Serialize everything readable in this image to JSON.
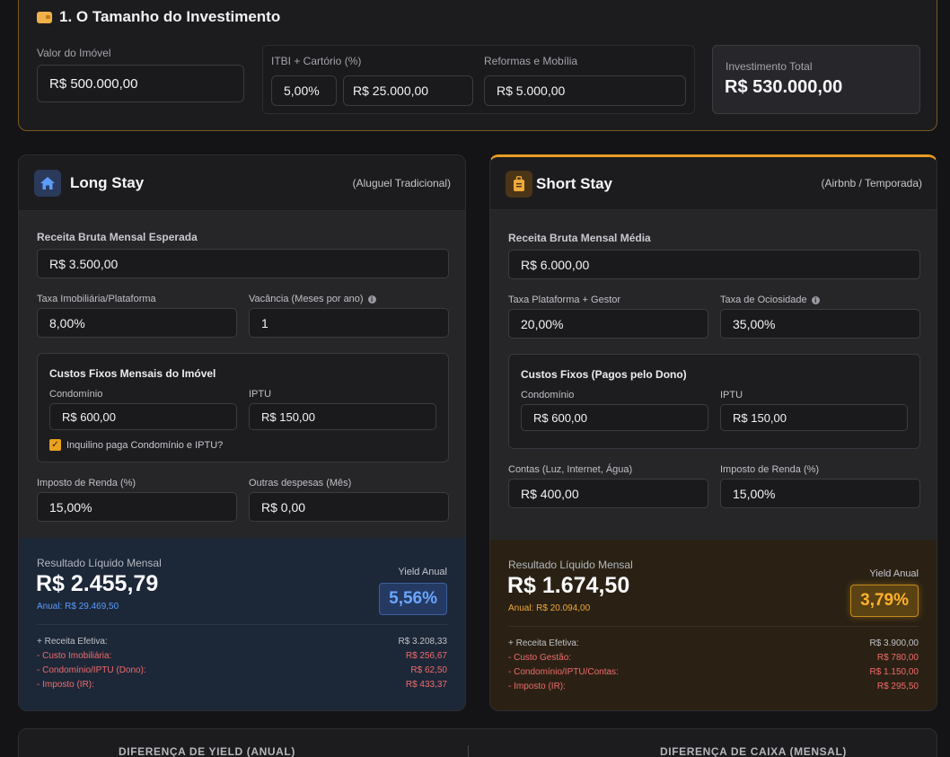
{
  "investment": {
    "title": "1. O Tamanho do Investimento",
    "property_value_label": "Valor do Imóvel",
    "property_value": "R$ 500.000,00",
    "itbi_label": "ITBI + Cartório (%)",
    "itbi_percent": "5,00%",
    "itbi_amount": "R$ 25.000,00",
    "renovation_label": "Reformas e Mobília",
    "renovation_value": "R$ 5.000,00",
    "total_label": "Investimento Total",
    "total_value": "R$ 530.000,00"
  },
  "long_stay": {
    "title": "Long Stay",
    "subtitle": "(Aluguel Tradicional)",
    "gross_label": "Receita Bruta Mensal Esperada",
    "gross_value": "R$ 3.500,00",
    "fee_label": "Taxa Imobiliária/Plataforma",
    "fee_value": "8,00%",
    "vacancy_label": "Vacância (Meses por ano)",
    "vacancy_value": "1",
    "fixed_title": "Custos Fixos Mensais do Imóvel",
    "condo_label": "Condomínio",
    "condo_value": "R$ 600,00",
    "iptu_label": "IPTU",
    "iptu_value": "R$ 150,00",
    "tenant_pays_label": "Inquilino paga Condomínio e IPTU?",
    "tax_label": "Imposto de Renda (%)",
    "tax_value": "15,00%",
    "other_label": "Outras despesas (Mês)",
    "other_value": "R$ 0,00",
    "result_label": "Resultado Líquido Mensal",
    "result_value": "R$ 2.455,79",
    "annual": "Anual: R$ 29.469,50",
    "yield_label": "Yield Anual",
    "yield_value": "5,56%",
    "breakdown": [
      {
        "label": "+ Receita Efetiva:",
        "value": "R$ 3.208,33"
      },
      {
        "label": "- Custo Imobiliária:",
        "value": "R$ 256,67"
      },
      {
        "label": "- Condomínio/IPTU (Dono):",
        "value": "R$ 62,50"
      },
      {
        "label": "- Imposto (IR):",
        "value": "R$ 433,37"
      }
    ]
  },
  "short_stay": {
    "title": "Short Stay",
    "subtitle": "(Airbnb / Temporada)",
    "gross_label": "Receita Bruta Mensal Média",
    "gross_value": "R$ 6.000,00",
    "fee_label": "Taxa Plataforma + Gestor",
    "fee_value": "20,00%",
    "idle_label": "Taxa de Ociosidade",
    "idle_value": "35,00%",
    "fixed_title": "Custos Fixos (Pagos pelo Dono)",
    "condo_label": "Condomínio",
    "condo_value": "R$ 600,00",
    "iptu_label": "IPTU",
    "iptu_value": "R$ 150,00",
    "bills_label": "Contas (Luz, Internet, Água)",
    "bills_value": "R$ 400,00",
    "tax_label": "Imposto de Renda (%)",
    "tax_value": "15,00%",
    "result_label": "Resultado Líquido Mensal",
    "result_value": "R$ 1.674,50",
    "annual": "Anual: R$ 20.094,00",
    "yield_label": "Yield Anual",
    "yield_value": "3,79%",
    "breakdown": [
      {
        "label": "+ Receita Efetiva:",
        "value": "R$ 3.900,00"
      },
      {
        "label": "- Custo Gestão:",
        "value": "R$ 780,00"
      },
      {
        "label": "- Condomínio/IPTU/Contas:",
        "value": "R$ 1.150,00"
      },
      {
        "label": "- Imposto (IR):",
        "value": "R$ 295,50"
      }
    ]
  },
  "difference": {
    "yield_label": "DIFERENÇA DE YIELD (ANUAL)",
    "cash_label": "DIFERENÇA DE CAIXA (MENSAL)"
  },
  "colors": {
    "long_accent": "#5b9cff",
    "short_accent": "#f0a93a",
    "negative": "#f26b6b"
  }
}
